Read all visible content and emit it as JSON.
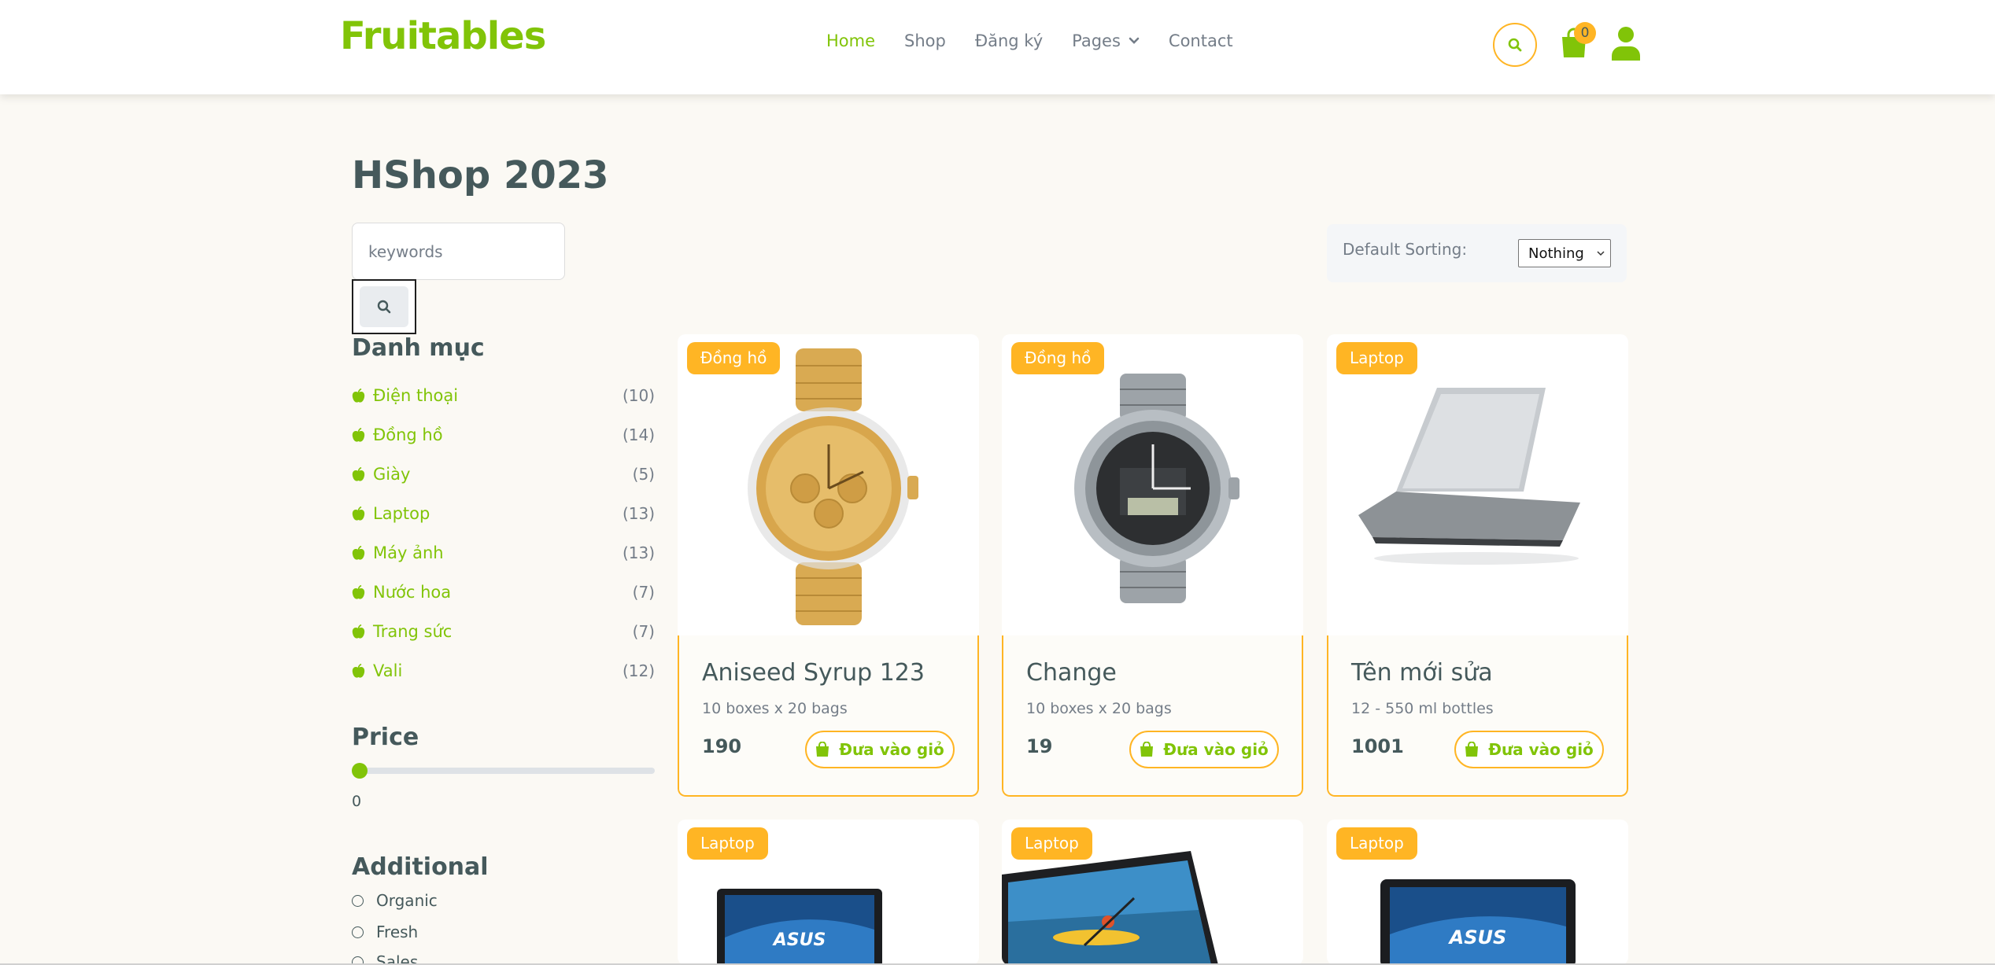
{
  "header": {
    "brand": "Fruitables",
    "nav": [
      {
        "label": "Home",
        "active": true
      },
      {
        "label": "Shop"
      },
      {
        "label": "Đăng ký"
      },
      {
        "label": "Pages",
        "has_dropdown": true
      },
      {
        "label": "Contact"
      }
    ],
    "cart_count": "0",
    "icons": [
      "search-icon",
      "shopping-bag-icon",
      "user-icon"
    ]
  },
  "page": {
    "title": "HShop 2023",
    "search_placeholder": "keywords",
    "sort_label": "Default Sorting:",
    "sort_selected": "Nothing"
  },
  "sidebar": {
    "categories_title": "Danh mục",
    "categories": [
      {
        "name": "Điện thoại",
        "count": "(10)"
      },
      {
        "name": "Đồng hồ",
        "count": "(14)"
      },
      {
        "name": "Giày",
        "count": "(5)"
      },
      {
        "name": "Laptop",
        "count": "(13)"
      },
      {
        "name": "Máy ảnh",
        "count": "(13)"
      },
      {
        "name": "Nước hoa",
        "count": "(7)"
      },
      {
        "name": "Trang sức",
        "count": "(7)"
      },
      {
        "name": "Vali",
        "count": "(12)"
      }
    ],
    "price_title": "Price",
    "price_value": "0",
    "price_level": 0,
    "additional_title": "Additional",
    "additional_options": [
      "Organic",
      "Fresh",
      "Sales"
    ]
  },
  "products": [
    {
      "badge": "Đồng hồ",
      "name": "Aniseed Syrup 123",
      "desc": "10 boxes x 20 bags",
      "price": "190",
      "cart_label": "Đưa vào giỏ",
      "image": "gold-watch"
    },
    {
      "badge": "Đồng hồ",
      "name": "Change",
      "desc": "10 boxes x 20 bags",
      "price": "19",
      "cart_label": "Đưa vào giỏ",
      "image": "silver-watch"
    },
    {
      "badge": "Laptop",
      "name": "Tên mới sửa",
      "desc": "12 - 550 ml bottles",
      "price": "1001",
      "cart_label": "Đưa vào giỏ",
      "image": "silver-laptop"
    },
    {
      "badge": "Laptop",
      "image": "asus-laptop"
    },
    {
      "badge": "Laptop",
      "image": "kayak-laptop"
    },
    {
      "badge": "Laptop",
      "image": "asus-laptop"
    }
  ],
  "colors": {
    "accent_green": "#81c408",
    "accent_orange": "#ffb524",
    "text_dark": "#45595b",
    "text_muted": "#747d88"
  }
}
